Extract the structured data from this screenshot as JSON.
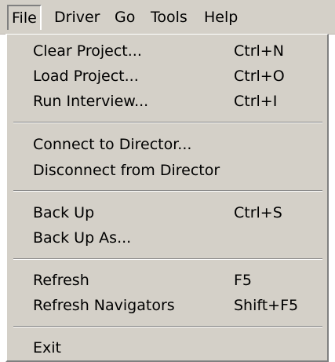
{
  "menubar": {
    "items": [
      {
        "label": "File"
      },
      {
        "label": "Driver"
      },
      {
        "label": "Go"
      },
      {
        "label": "Tools"
      },
      {
        "label": "Help"
      }
    ]
  },
  "file_menu": {
    "items": [
      {
        "label": "Clear Project...",
        "shortcut": "Ctrl+N"
      },
      {
        "label": "Load Project...",
        "shortcut": "Ctrl+O"
      },
      {
        "label": "Run Interview...",
        "shortcut": "Ctrl+I"
      },
      {
        "label": "Connect to Director...",
        "shortcut": ""
      },
      {
        "label": "Disconnect from Director",
        "shortcut": ""
      },
      {
        "label": "Back Up",
        "shortcut": "Ctrl+S"
      },
      {
        "label": "Back Up As...",
        "shortcut": ""
      },
      {
        "label": "Refresh",
        "shortcut": "F5"
      },
      {
        "label": "Refresh Navigators",
        "shortcut": "Shift+F5"
      },
      {
        "label": "Exit",
        "shortcut": ""
      }
    ]
  },
  "colors": {
    "menu_background": "#d4d0c8",
    "shadow": "#808080",
    "highlight": "#ffffff"
  }
}
